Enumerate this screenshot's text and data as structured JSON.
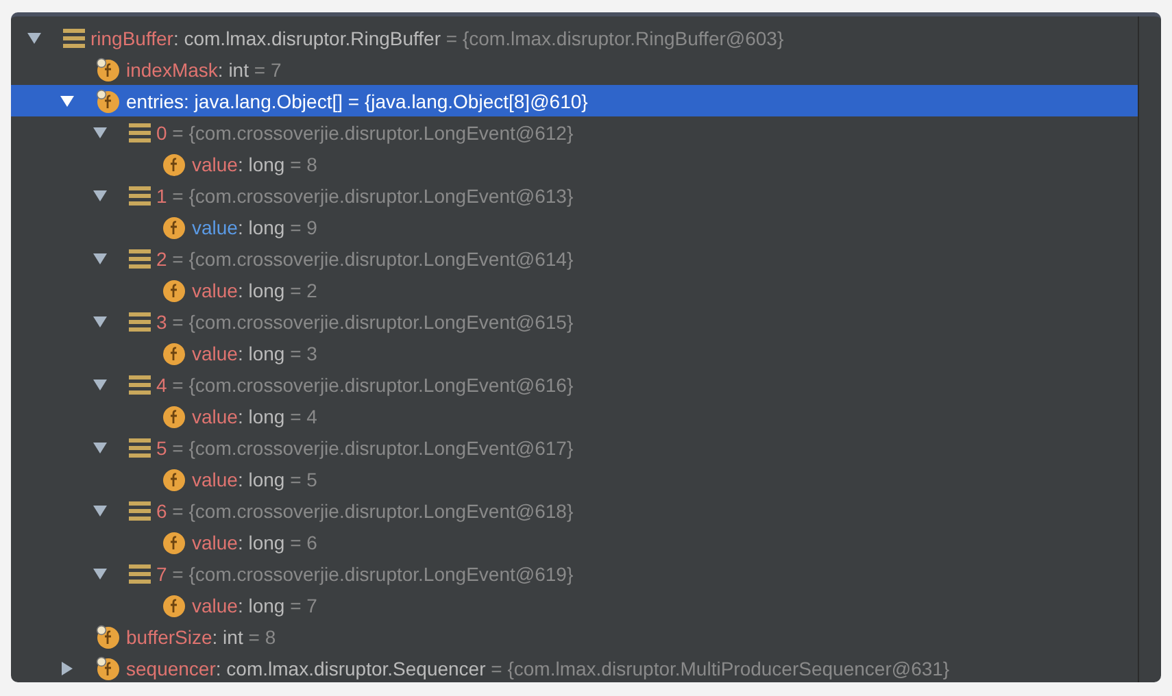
{
  "variables": [
    {
      "kind": "object",
      "name": "ringBuffer",
      "type": ": com.lmax.disruptor.RingBuffer",
      "value": " = {com.lmax.disruptor.RingBuffer@603}",
      "expanded": true,
      "selected": false,
      "changed": false,
      "children": [
        {
          "kind": "final_field",
          "name": "indexMask",
          "type": ": int",
          "value": " = 7",
          "selected": false,
          "changed": false
        },
        {
          "kind": "final_field",
          "name": "entries",
          "type": ": java.lang.Object[]",
          "value": " = {java.lang.Object[8]@610}",
          "expanded": true,
          "selected": true,
          "changed": false,
          "children": [
            {
              "kind": "object",
              "name": "0",
              "value": " = {com.crossoverjie.disruptor.LongEvent@612}",
              "expanded": true,
              "selected": false,
              "changed": false,
              "children": [
                {
                  "kind": "field",
                  "name": "value",
                  "type": ": long",
                  "value": " = 8",
                  "selected": false,
                  "changed": false
                }
              ]
            },
            {
              "kind": "object",
              "name": "1",
              "value": " = {com.crossoverjie.disruptor.LongEvent@613}",
              "expanded": true,
              "selected": false,
              "changed": false,
              "children": [
                {
                  "kind": "field",
                  "name": "value",
                  "type": ": long",
                  "value": " = 9",
                  "selected": false,
                  "changed": true
                }
              ]
            },
            {
              "kind": "object",
              "name": "2",
              "value": " = {com.crossoverjie.disruptor.LongEvent@614}",
              "expanded": true,
              "selected": false,
              "changed": false,
              "children": [
                {
                  "kind": "field",
                  "name": "value",
                  "type": ": long",
                  "value": " = 2",
                  "selected": false,
                  "changed": false
                }
              ]
            },
            {
              "kind": "object",
              "name": "3",
              "value": " = {com.crossoverjie.disruptor.LongEvent@615}",
              "expanded": true,
              "selected": false,
              "changed": false,
              "children": [
                {
                  "kind": "field",
                  "name": "value",
                  "type": ": long",
                  "value": " = 3",
                  "selected": false,
                  "changed": false
                }
              ]
            },
            {
              "kind": "object",
              "name": "4",
              "value": " = {com.crossoverjie.disruptor.LongEvent@616}",
              "expanded": true,
              "selected": false,
              "changed": false,
              "children": [
                {
                  "kind": "field",
                  "name": "value",
                  "type": ": long",
                  "value": " = 4",
                  "selected": false,
                  "changed": false
                }
              ]
            },
            {
              "kind": "object",
              "name": "5",
              "value": " = {com.crossoverjie.disruptor.LongEvent@617}",
              "expanded": true,
              "selected": false,
              "changed": false,
              "children": [
                {
                  "kind": "field",
                  "name": "value",
                  "type": ": long",
                  "value": " = 5",
                  "selected": false,
                  "changed": false
                }
              ]
            },
            {
              "kind": "object",
              "name": "6",
              "value": " = {com.crossoverjie.disruptor.LongEvent@618}",
              "expanded": true,
              "selected": false,
              "changed": false,
              "children": [
                {
                  "kind": "field",
                  "name": "value",
                  "type": ": long",
                  "value": " = 6",
                  "selected": false,
                  "changed": false
                }
              ]
            },
            {
              "kind": "object",
              "name": "7",
              "value": " = {com.crossoverjie.disruptor.LongEvent@619}",
              "expanded": true,
              "selected": false,
              "changed": false,
              "children": [
                {
                  "kind": "field",
                  "name": "value",
                  "type": ": long",
                  "value": " = 7",
                  "selected": false,
                  "changed": false
                }
              ]
            }
          ]
        },
        {
          "kind": "final_field",
          "name": "bufferSize",
          "type": ": int",
          "value": " = 8",
          "selected": false,
          "changed": false
        },
        {
          "kind": "final_field",
          "name": "sequencer",
          "type": ": com.lmax.disruptor.Sequencer",
          "value": " = {com.lmax.disruptor.MultiProducerSequencer@631}",
          "expanded": false,
          "selected": false,
          "changed": false
        }
      ]
    }
  ]
}
